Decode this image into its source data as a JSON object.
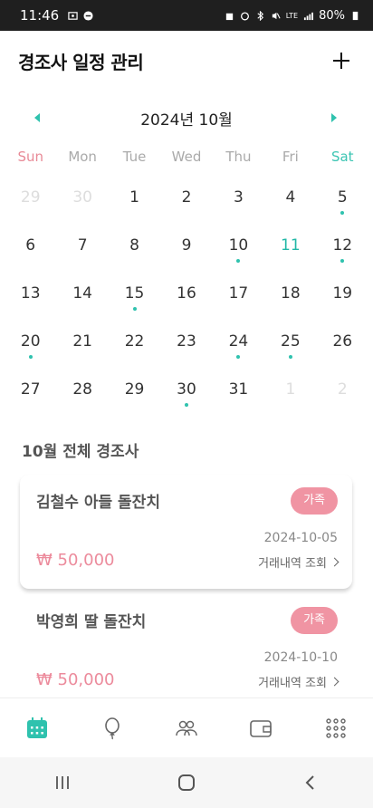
{
  "status_bar": {
    "time": "11:46",
    "battery": "80%",
    "network": "LTE"
  },
  "header": {
    "title": "경조사 일정 관리",
    "add_icon": "plus-icon"
  },
  "calendar": {
    "month_title": "2024년 10월",
    "weekdays": [
      "Sun",
      "Mon",
      "Tue",
      "Wed",
      "Thu",
      "Fri",
      "Sat"
    ],
    "days": [
      {
        "label": "29",
        "muted": true,
        "dot": false
      },
      {
        "label": "30",
        "muted": true,
        "dot": false
      },
      {
        "label": "1",
        "muted": false,
        "dot": false
      },
      {
        "label": "2",
        "muted": false,
        "dot": false
      },
      {
        "label": "3",
        "muted": false,
        "dot": false
      },
      {
        "label": "4",
        "muted": false,
        "dot": false
      },
      {
        "label": "5",
        "muted": false,
        "dot": true
      },
      {
        "label": "6",
        "muted": false,
        "dot": false
      },
      {
        "label": "7",
        "muted": false,
        "dot": false
      },
      {
        "label": "8",
        "muted": false,
        "dot": false
      },
      {
        "label": "9",
        "muted": false,
        "dot": false
      },
      {
        "label": "10",
        "muted": false,
        "dot": true
      },
      {
        "label": "11",
        "muted": false,
        "dot": false,
        "today": true
      },
      {
        "label": "12",
        "muted": false,
        "dot": true
      },
      {
        "label": "13",
        "muted": false,
        "dot": false
      },
      {
        "label": "14",
        "muted": false,
        "dot": false
      },
      {
        "label": "15",
        "muted": false,
        "dot": true
      },
      {
        "label": "16",
        "muted": false,
        "dot": false
      },
      {
        "label": "17",
        "muted": false,
        "dot": false
      },
      {
        "label": "18",
        "muted": false,
        "dot": false
      },
      {
        "label": "19",
        "muted": false,
        "dot": false
      },
      {
        "label": "20",
        "muted": false,
        "dot": true
      },
      {
        "label": "21",
        "muted": false,
        "dot": false
      },
      {
        "label": "22",
        "muted": false,
        "dot": false
      },
      {
        "label": "23",
        "muted": false,
        "dot": false
      },
      {
        "label": "24",
        "muted": false,
        "dot": true
      },
      {
        "label": "25",
        "muted": false,
        "dot": true
      },
      {
        "label": "26",
        "muted": false,
        "dot": false
      },
      {
        "label": "27",
        "muted": false,
        "dot": false
      },
      {
        "label": "28",
        "muted": false,
        "dot": false
      },
      {
        "label": "29",
        "muted": false,
        "dot": false
      },
      {
        "label": "30",
        "muted": false,
        "dot": true
      },
      {
        "label": "31",
        "muted": false,
        "dot": false
      },
      {
        "label": "1",
        "muted": true,
        "dot": false
      },
      {
        "label": "2",
        "muted": true,
        "dot": false
      }
    ]
  },
  "events_section": {
    "title": "10월 전체 경조사",
    "events": [
      {
        "name": "김철수 아들 돌잔치",
        "tag": "가족",
        "date": "2024-10-05",
        "amount": "₩ 50,000",
        "link": "거래내역 조회"
      },
      {
        "name": "박영희 딸 돌잔치",
        "tag": "가족",
        "date": "2024-10-10",
        "amount": "₩ 50,000",
        "link": "거래내역 조회"
      }
    ]
  },
  "bottom_nav": {
    "items": [
      "calendar-icon",
      "balloon-icon",
      "people-icon",
      "wallet-icon",
      "grid-menu-icon"
    ],
    "active": "calendar-icon"
  },
  "colors": {
    "accent": "#2fc2ae",
    "pink": "#f094a3",
    "sunday": "#e88a97",
    "saturday": "#3cc5b3"
  }
}
